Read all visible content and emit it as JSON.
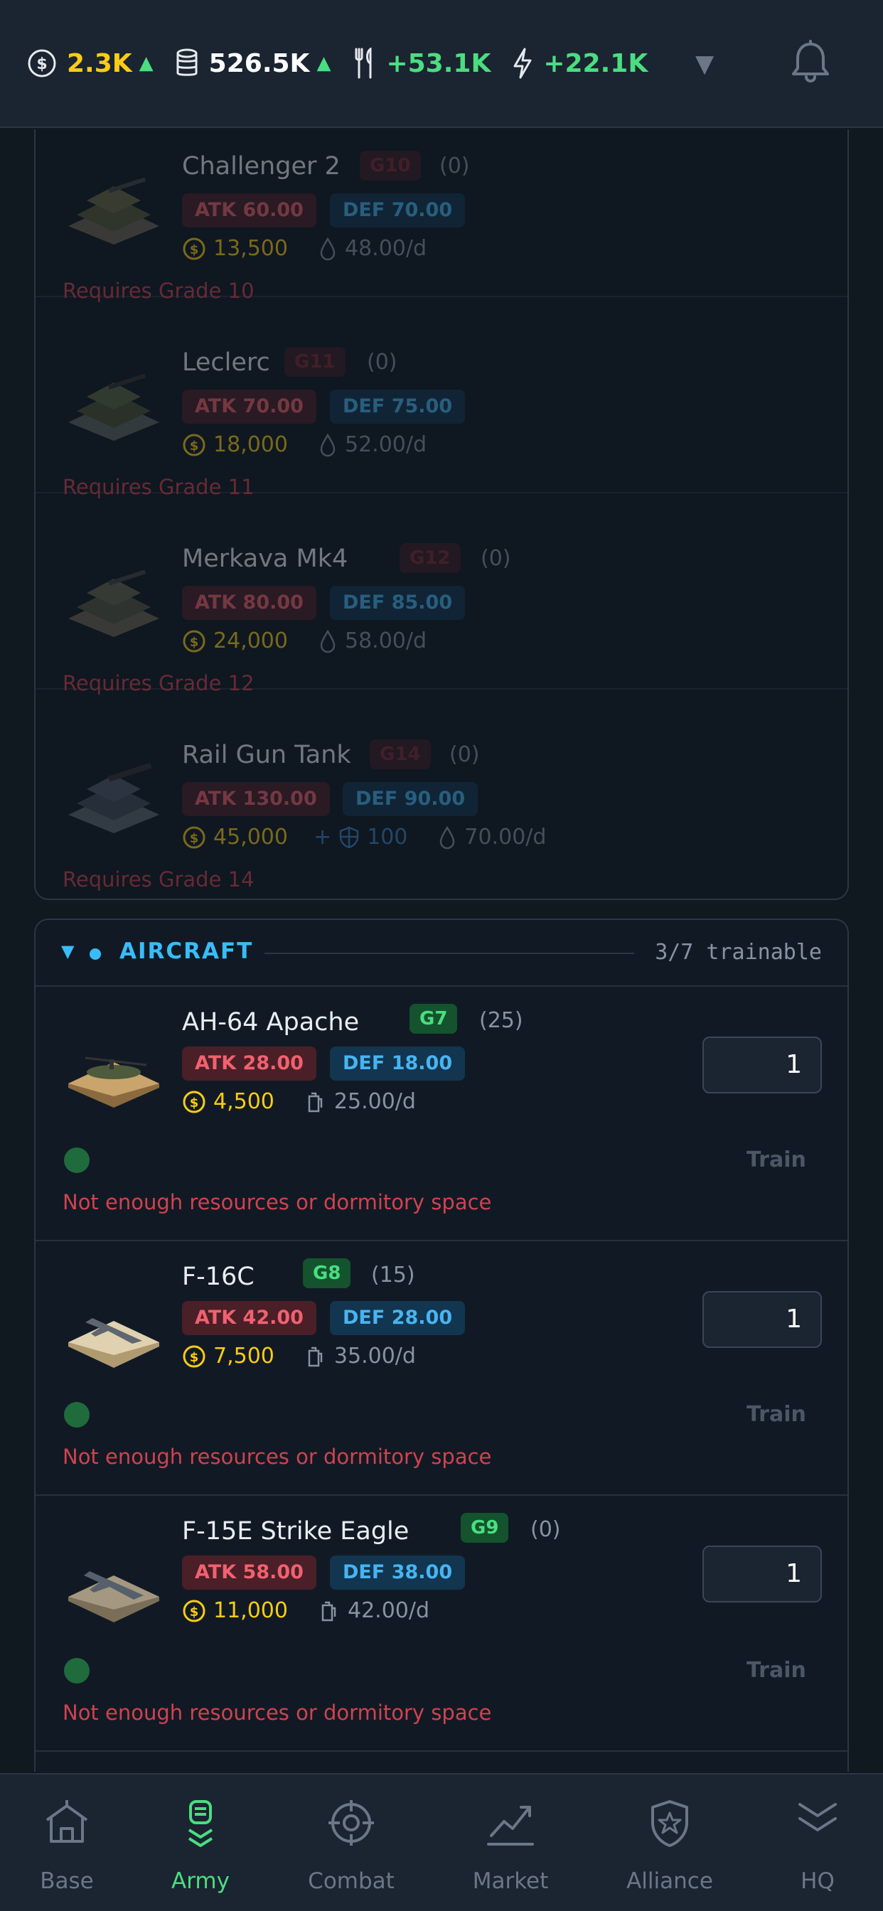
{
  "topbar": {
    "resources": [
      {
        "name": "coins",
        "value": "2.3K",
        "trend": "▲"
      },
      {
        "name": "database",
        "value": "526.5K",
        "trend": "▲"
      },
      {
        "name": "food",
        "value": "+53.1K"
      },
      {
        "name": "energy",
        "value": "+22.1K"
      }
    ],
    "dropdown_glyph": "▼"
  },
  "locked_units": [
    {
      "name": "Challenger 2",
      "grade": "G10",
      "count": "(0)",
      "atk": "ATK 60.00",
      "def": "DEF 70.00",
      "cost": "13,500",
      "upkeep": "48.00/d",
      "requirement": "Requires Grade 10"
    },
    {
      "name": "Leclerc",
      "grade": "G11",
      "count": "(0)",
      "atk": "ATK 70.00",
      "def": "DEF 75.00",
      "cost": "18,000",
      "upkeep": "52.00/d",
      "requirement": "Requires Grade 11"
    },
    {
      "name": "Merkava Mk4",
      "grade": "G12",
      "count": "(0)",
      "atk": "ATK 80.00",
      "def": "DEF 85.00",
      "cost": "24,000",
      "upkeep": "58.00/d",
      "requirement": "Requires Grade 12"
    },
    {
      "name": "Rail Gun Tank",
      "grade": "G14",
      "count": "(0)",
      "atk": "ATK 130.00",
      "def": "DEF 90.00",
      "cost": "45,000",
      "extra_plus": "+",
      "extra_value": "100",
      "upkeep": "70.00/d",
      "requirement": "Requires Grade 14"
    }
  ],
  "aircraft": {
    "title": "AIRCRAFT",
    "toggle_glyph": "▼",
    "trainable": "3/7 trainable",
    "units": [
      {
        "name": "AH-64 Apache",
        "grade": "G7",
        "count": "(25)",
        "atk": "ATK 28.00",
        "def": "DEF 18.00",
        "cost": "4,500",
        "upkeep": "25.00/d",
        "quantity": "1",
        "train_label": "Train",
        "warning": "Not enough resources or dormitory space"
      },
      {
        "name": "F-16C",
        "grade": "G8",
        "count": "(15)",
        "atk": "ATK 42.00",
        "def": "DEF 28.00",
        "cost": "7,500",
        "upkeep": "35.00/d",
        "quantity": "1",
        "train_label": "Train",
        "warning": "Not enough resources or dormitory space"
      },
      {
        "name": "F-15E Strike Eagle",
        "grade": "G9",
        "count": "(0)",
        "atk": "ATK 58.00",
        "def": "DEF 38.00",
        "cost": "11,000",
        "upkeep": "42.00/d",
        "quantity": "1",
        "train_label": "Train",
        "warning": "Not enough resources or dormitory space"
      }
    ]
  },
  "nav": [
    {
      "label": "Base",
      "icon": "house-icon"
    },
    {
      "label": "Army",
      "icon": "soldier-icon",
      "active": true
    },
    {
      "label": "Combat",
      "icon": "crosshair-icon"
    },
    {
      "label": "Market",
      "icon": "chart-line-icon"
    },
    {
      "label": "Alliance",
      "icon": "shield-star-icon"
    },
    {
      "label": "HQ",
      "icon": "chevrons-down-icon"
    }
  ],
  "colors": {
    "background": "#101820",
    "accent_blue": "#38bdf8",
    "accent_green": "#4ade80",
    "gold": "#facc15",
    "atk_red": "#f0616f",
    "warning_red": "#d0424f"
  }
}
